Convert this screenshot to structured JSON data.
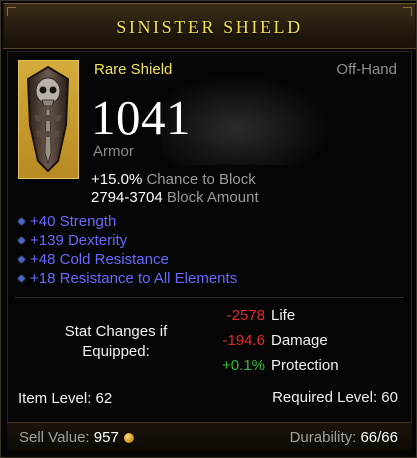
{
  "item": {
    "name": "SINISTER SHIELD",
    "rarity": "Rare Shield",
    "slot": "Off-Hand",
    "armor_value": "1041",
    "armor_label": "Armor",
    "icon": "skull-shield-icon"
  },
  "block": {
    "chance_value": "+15.0%",
    "chance_label": "Chance to Block",
    "amount_value": "2794-3704",
    "amount_label": "Block Amount"
  },
  "affixes": [
    "+40 Strength",
    "+139 Dexterity",
    "+48 Cold Resistance",
    "+18 Resistance to All Elements"
  ],
  "stat_changes": {
    "title_line1": "Stat Changes if",
    "title_line2": "Equipped:",
    "rows": [
      {
        "value": "-2578",
        "label": "Life",
        "sign": "negative"
      },
      {
        "value": "-194.6",
        "label": "Damage",
        "sign": "negative"
      },
      {
        "value": "+0.1%",
        "label": "Protection",
        "sign": "positive"
      }
    ]
  },
  "levels": {
    "item_level": "Item Level: 62",
    "required_level": "Required Level: 60"
  },
  "footer": {
    "sell_label": "Sell Value:",
    "sell_value": "957",
    "durability_label": "Durability:",
    "durability_value": "66/66"
  },
  "colors": {
    "title": "#f0e056",
    "rarity": "#f2e45a",
    "affix": "#6969ff",
    "negative": "#e32a2a",
    "positive": "#2fbf2f"
  }
}
